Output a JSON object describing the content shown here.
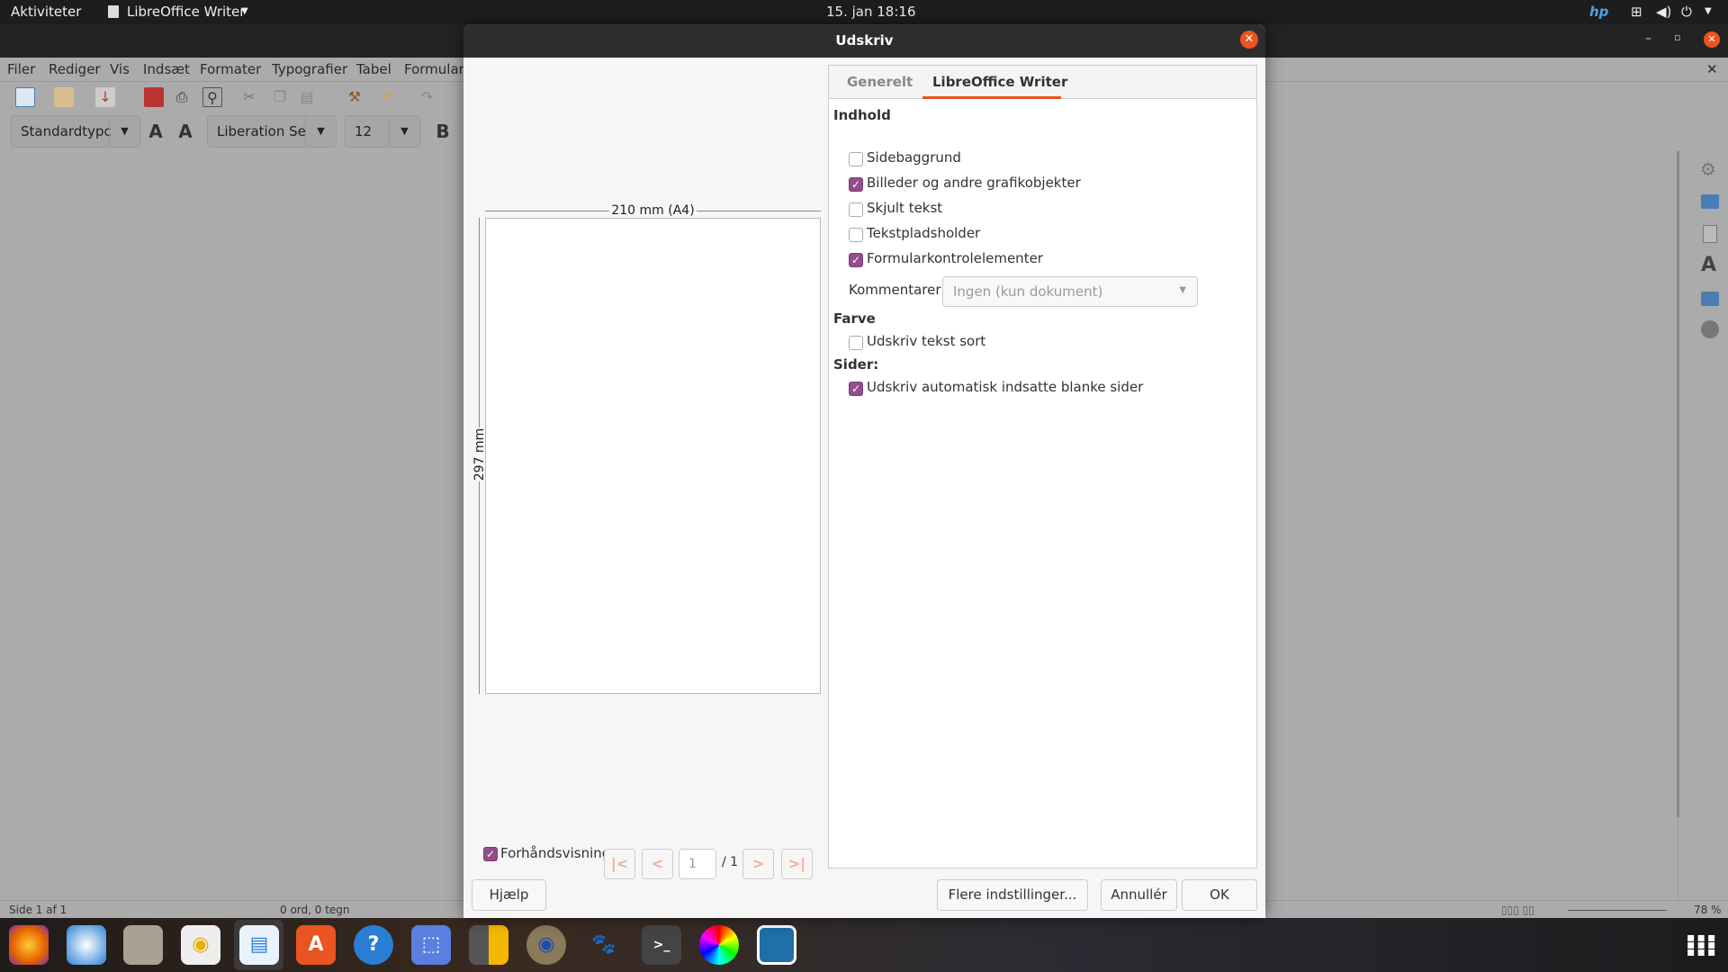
{
  "topbar": {
    "activities": "Aktiviteter",
    "app_menu": "LibreOffice Writer",
    "clock": "15. jan  18:16"
  },
  "menu": [
    "Filer",
    "Rediger",
    "Vis",
    "Indsæt",
    "Formater",
    "Typografier",
    "Tabel",
    "Formular"
  ],
  "toolbar": {
    "paragraph_style": "Standardtypc",
    "font_name": "Liberation Se",
    "font_size": "12",
    "bold": "B"
  },
  "status": {
    "page": "Side 1 af 1",
    "words": "0 ord, 0 tegn",
    "zoom": "78 %"
  },
  "dialog": {
    "title": "Udskriv",
    "preview": {
      "width_label": "210 mm (A4)",
      "height_label": "297 mm",
      "preview_checkbox": "Forhåndsvisning",
      "preview_checked": true,
      "page": "1",
      "total": "/ 1"
    },
    "tabs": [
      {
        "label": "Generelt",
        "active": false
      },
      {
        "label": "LibreOffice Writer",
        "active": true
      }
    ],
    "sections": {
      "content": "Indhold",
      "color": "Farve",
      "pages": "Sider:"
    },
    "options": [
      {
        "label": "Sidebaggrund",
        "checked": false
      },
      {
        "label": "Billeder og andre grafikobjekter",
        "checked": true
      },
      {
        "label": "Skjult tekst",
        "checked": false
      },
      {
        "label": "Tekstpladsholder",
        "checked": false
      },
      {
        "label": "Formularkontrolelementer",
        "checked": true
      }
    ],
    "comments_label": "Kommentarer:",
    "comments_value": "Ingen (kun dokument)",
    "color_option": {
      "label": "Udskriv tekst sort",
      "checked": false
    },
    "pages_option": {
      "label": "Udskriv automatisk indsatte blanke sider",
      "checked": true
    },
    "buttons": {
      "help": "Hjælp",
      "more": "Flere indstillinger...",
      "cancel": "Annullér",
      "ok": "OK"
    }
  },
  "colors": {
    "accent": "#e95420",
    "checkbox": "#924d8b"
  },
  "dock": [
    "firefox",
    "thunderbird",
    "files",
    "rhythmbox",
    "libreoffice-writer",
    "software",
    "help",
    "screenshot",
    "calculator",
    "webcam",
    "gimp",
    "terminal",
    "color-picker",
    "image-viewer"
  ]
}
